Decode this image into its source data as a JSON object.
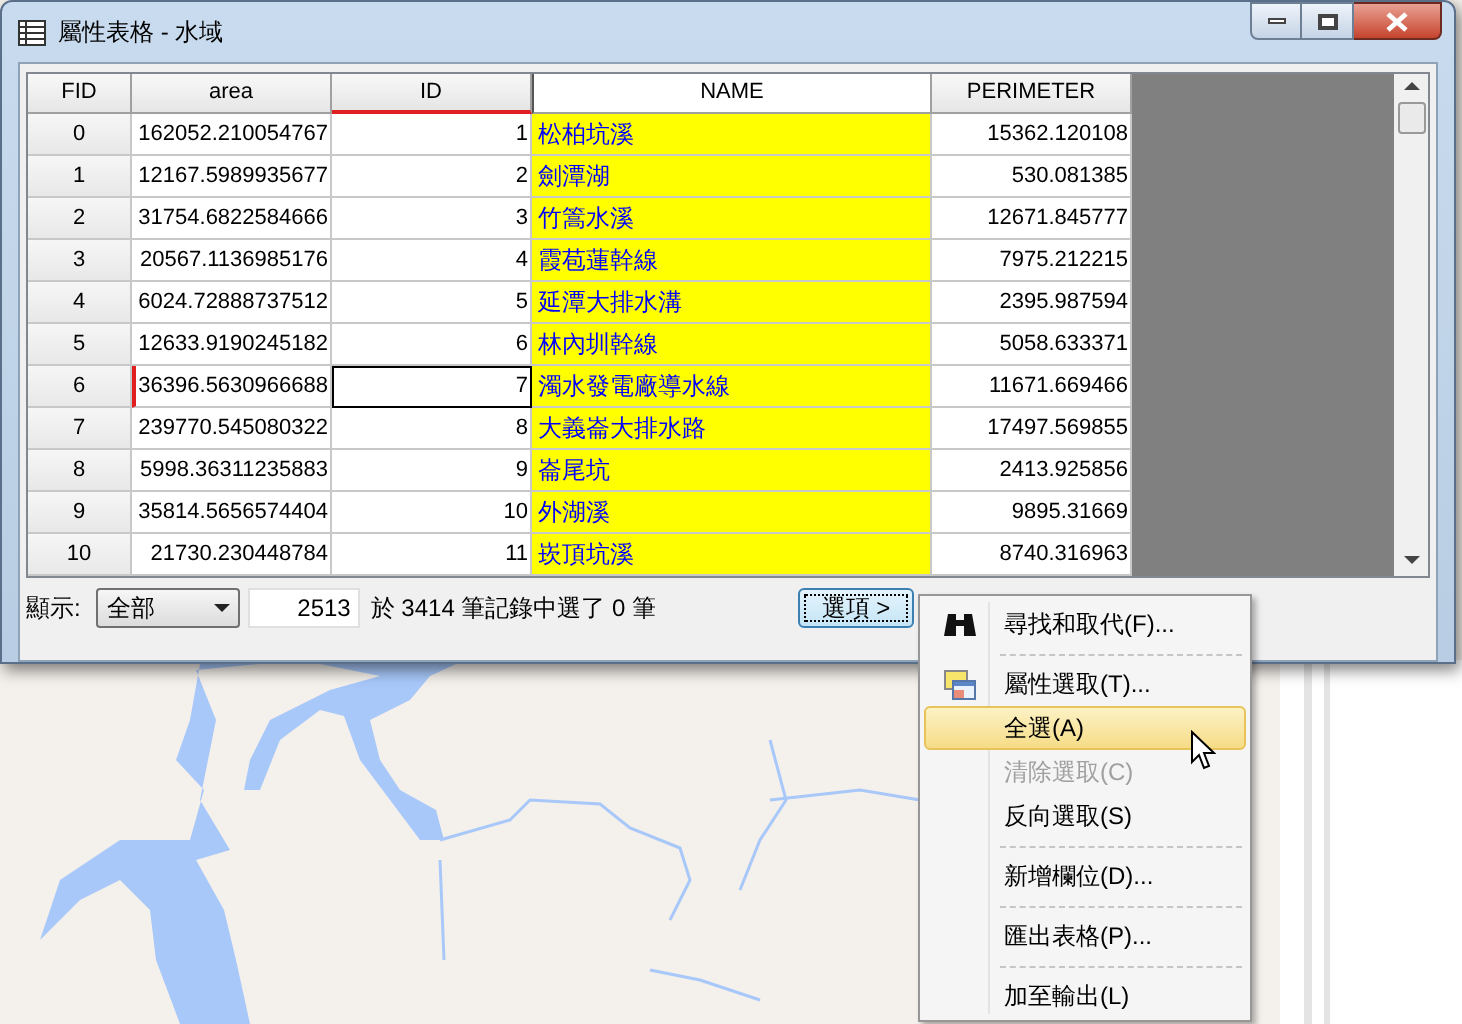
{
  "window": {
    "title": "屬性表格 - 水域"
  },
  "table": {
    "columns": [
      {
        "label": "FID",
        "current": false,
        "highlighted": false
      },
      {
        "label": "area",
        "current": false,
        "highlighted": false
      },
      {
        "label": "ID",
        "current": true,
        "highlighted": false
      },
      {
        "label": "NAME",
        "current": false,
        "highlighted": true
      },
      {
        "label": "PERIMETER",
        "current": false,
        "highlighted": false
      }
    ],
    "rows": [
      {
        "cells": [
          "0",
          "162052.210054767",
          "1",
          "松柏坑溪",
          "15362.120108"
        ],
        "current": false
      },
      {
        "cells": [
          "1",
          "12167.5989935677",
          "2",
          "劍潭湖",
          "530.081385"
        ],
        "current": false
      },
      {
        "cells": [
          "2",
          "31754.6822584666",
          "3",
          "竹篙水溪",
          "12671.845777"
        ],
        "current": false
      },
      {
        "cells": [
          "3",
          "20567.1136985176",
          "4",
          "霞苞蓮幹線",
          "7975.212215"
        ],
        "current": false
      },
      {
        "cells": [
          "4",
          "6024.72888737512",
          "5",
          "延潭大排水溝",
          "2395.987594"
        ],
        "current": false
      },
      {
        "cells": [
          "5",
          "12633.9190245182",
          "6",
          "林內圳幹線",
          "5058.633371"
        ],
        "current": false
      },
      {
        "cells": [
          "6",
          "36396.5630966688",
          "7",
          "濁水發電廠導水線",
          "11671.669466"
        ],
        "current": true
      },
      {
        "cells": [
          "7",
          "239770.545080322",
          "8",
          "大義崙大排水路",
          "17497.569855"
        ],
        "current": false
      },
      {
        "cells": [
          "8",
          "5998.36311235883",
          "9",
          "崙尾坑",
          "2413.925856"
        ],
        "current": false
      },
      {
        "cells": [
          "9",
          "35814.5656574404",
          "10",
          "外湖溪",
          "9895.31669"
        ],
        "current": false
      },
      {
        "cells": [
          "10",
          "21730.230448784",
          "11",
          "崁頂坑溪",
          "8740.316963"
        ],
        "current": false
      }
    ]
  },
  "footer": {
    "show_label": "顯示:",
    "show_value": "全部",
    "record_field": "2513",
    "record_text": "於 3414 筆記錄中選了 0 筆",
    "options_button": "選項 >"
  },
  "menu": {
    "items": [
      {
        "label": "尋找和取代(F)...",
        "kind": "find",
        "selected": false,
        "disabled": false,
        "separator_after": true
      },
      {
        "label": "屬性選取(T)...",
        "kind": "query",
        "selected": false,
        "disabled": false,
        "separator_after": false
      },
      {
        "label": "全選(A)",
        "kind": "plain",
        "selected": true,
        "disabled": false,
        "separator_after": false
      },
      {
        "label": "清除選取(C)",
        "kind": "plain",
        "selected": false,
        "disabled": true,
        "separator_after": false
      },
      {
        "label": "反向選取(S)",
        "kind": "plain",
        "selected": false,
        "disabled": false,
        "separator_after": true
      },
      {
        "label": "新增欄位(D)...",
        "kind": "plain",
        "selected": false,
        "disabled": false,
        "separator_after": true
      },
      {
        "label": "匯出表格(P)...",
        "kind": "plain",
        "selected": false,
        "disabled": false,
        "separator_after": true
      },
      {
        "label": "加至輸出(L)",
        "kind": "plain",
        "selected": false,
        "disabled": false,
        "separator_after": false
      }
    ]
  }
}
